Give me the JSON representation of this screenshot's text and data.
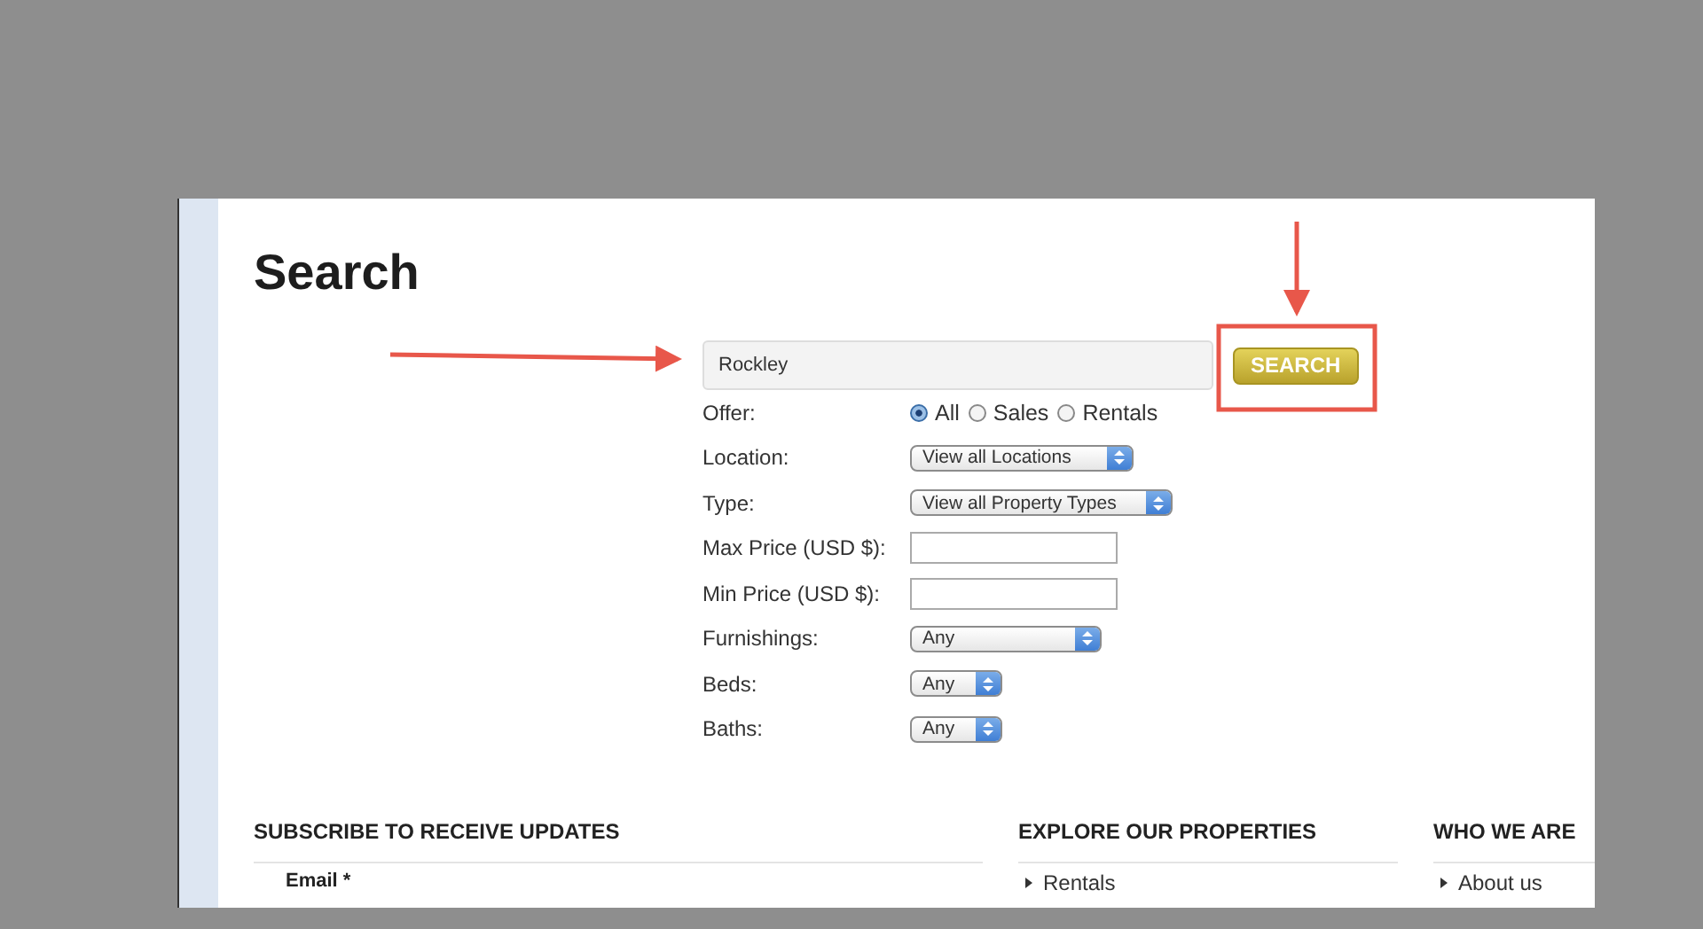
{
  "page_title": "Search",
  "search": {
    "value": "Rockley",
    "button": "SEARCH"
  },
  "offer": {
    "label": "Offer:",
    "options": [
      {
        "label": "All",
        "selected": true
      },
      {
        "label": "Sales",
        "selected": false
      },
      {
        "label": "Rentals",
        "selected": false
      }
    ]
  },
  "fields": [
    {
      "kind": "select",
      "label": "Location:",
      "value": "View all Locations"
    },
    {
      "kind": "select",
      "label": "Type:",
      "value": "View all Property Types"
    },
    {
      "kind": "text",
      "label": "Max Price (USD $):"
    },
    {
      "kind": "text",
      "label": "Min Price (USD $):"
    },
    {
      "kind": "select",
      "label": "Furnishings:",
      "value": "Any"
    },
    {
      "kind": "select",
      "label": "Beds:",
      "value": "Any"
    },
    {
      "kind": "select",
      "label": "Baths:",
      "value": "Any"
    }
  ],
  "footer": [
    {
      "heading": "SUBSCRIBE TO RECEIVE UPDATES",
      "field_label": "Email *"
    },
    {
      "heading": "EXPLORE OUR PROPERTIES",
      "links": [
        "Rentals"
      ]
    },
    {
      "heading": "WHO WE ARE",
      "links": [
        "About us"
      ]
    }
  ]
}
